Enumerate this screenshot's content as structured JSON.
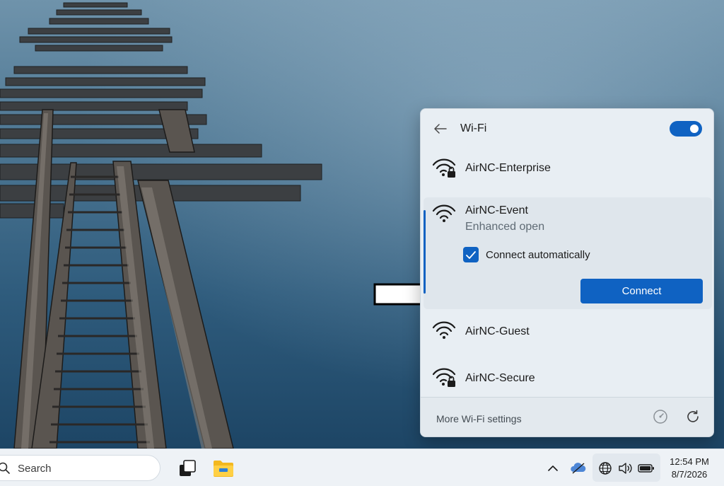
{
  "flyout": {
    "title": "Wi-Fi",
    "wifi_enabled": true,
    "networks": [
      {
        "name": "AirNC-Enterprise",
        "secured": true
      },
      {
        "name": "AirNC-Event",
        "status": "Enhanced open",
        "secured": false,
        "expanded": true
      },
      {
        "name": "AirNC-Guest",
        "secured": false
      },
      {
        "name": "AirNC-Secure",
        "secured": true
      }
    ],
    "connect_auto_label": "Connect automatically",
    "connect_auto_checked": true,
    "connect_button": "Connect",
    "footer": {
      "more_settings": "More Wi-Fi settings"
    }
  },
  "taskbar": {
    "search_label": "Search",
    "time": "12:54 PM",
    "date": "8/7/2026"
  },
  "colors": {
    "accent": "#0f62c2",
    "flyout_bg": "#e8eef3",
    "taskbar_bg": "#eef2f6"
  },
  "icons": [
    "back-arrow-icon",
    "wifi-lock-icon",
    "wifi-icon",
    "checkmark-icon",
    "speed-gauge-icon",
    "refresh-icon",
    "search-icon",
    "task-view-icon",
    "folder-icon",
    "chevron-up-icon",
    "onedrive-icon",
    "globe-icon",
    "volume-icon",
    "battery-icon"
  ]
}
